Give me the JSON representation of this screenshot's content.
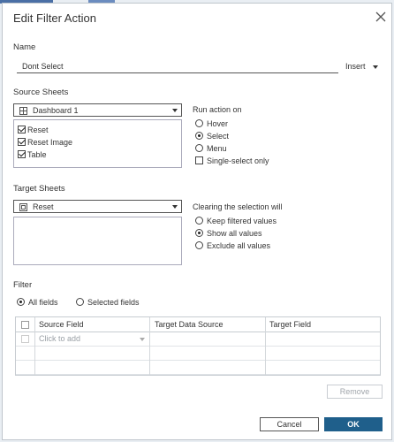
{
  "dialog": {
    "title": "Edit Filter Action"
  },
  "name": {
    "label": "Name",
    "value": "Dont Select",
    "insert_label": "Insert"
  },
  "source": {
    "label": "Source Sheets",
    "selected": "Dashboard 1",
    "sheets": [
      {
        "label": "Reset",
        "checked": true
      },
      {
        "label": "Reset Image",
        "checked": true
      },
      {
        "label": "Table",
        "checked": true
      }
    ]
  },
  "run_action": {
    "label": "Run action on",
    "options": [
      {
        "label": "Hover",
        "selected": false
      },
      {
        "label": "Select",
        "selected": true
      },
      {
        "label": "Menu",
        "selected": false
      }
    ],
    "single_select_label": "Single-select only",
    "single_select_checked": false
  },
  "target": {
    "label": "Target Sheets",
    "selected": "Reset"
  },
  "clearing": {
    "label": "Clearing the selection will",
    "options": [
      {
        "label": "Keep filtered values",
        "selected": false
      },
      {
        "label": "Show all values",
        "selected": true
      },
      {
        "label": "Exclude all values",
        "selected": false
      }
    ]
  },
  "filter": {
    "label": "Filter",
    "all_fields_label": "All fields",
    "selected_fields_label": "Selected fields",
    "mode": "all",
    "columns": [
      "Source Field",
      "Target Data Source",
      "Target Field"
    ],
    "placeholder": "Click to add"
  },
  "buttons": {
    "remove": "Remove",
    "cancel": "Cancel",
    "ok": "OK"
  },
  "colors": {
    "accent": "#1f5f8b",
    "border": "#555555"
  }
}
